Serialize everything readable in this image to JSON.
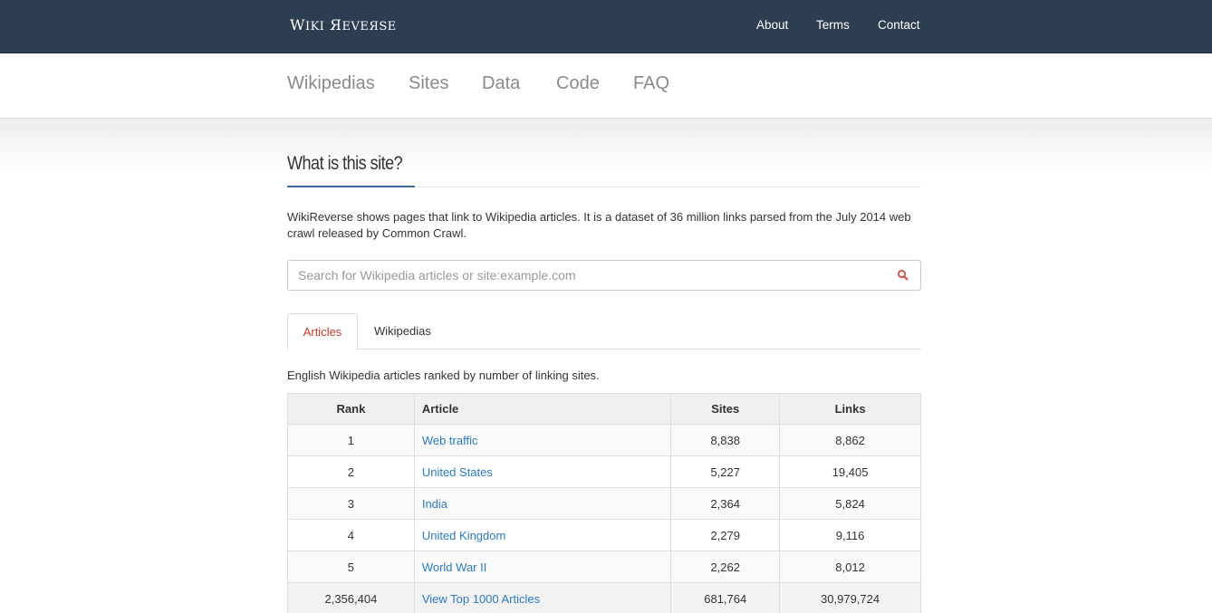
{
  "topbar": {
    "brand_part1": "W",
    "brand_part2": "IKI",
    "brand_part3": "Я",
    "brand_part4": "EVEЯSE",
    "links": [
      "About",
      "Terms",
      "Contact"
    ]
  },
  "subnav": {
    "items": [
      "Wikipedias",
      "Sites",
      "Data",
      "Code",
      "FAQ"
    ]
  },
  "main": {
    "heading": "What is this site?",
    "intro": "WikiReverse shows pages that link to Wikipedia articles. It is a dataset of 36 million links parsed from the July 2014 web crawl released by Common Crawl.",
    "search_placeholder": "Search for Wikipedia articles or site:example.com",
    "tabs": [
      "Articles",
      "Wikipedias"
    ],
    "caption": "English Wikipedia articles ranked by number of linking sites.",
    "table": {
      "headers": [
        "Rank",
        "Article",
        "Sites",
        "Links"
      ],
      "rows": [
        {
          "rank": "1",
          "article": "Web traffic",
          "sites": "8,838",
          "links": "8,862"
        },
        {
          "rank": "2",
          "article": "United States",
          "sites": "5,227",
          "links": "19,405"
        },
        {
          "rank": "3",
          "article": "India",
          "sites": "2,364",
          "links": "5,824"
        },
        {
          "rank": "4",
          "article": "United Kingdom",
          "sites": "2,279",
          "links": "9,116"
        },
        {
          "rank": "5",
          "article": "World War II",
          "sites": "2,262",
          "links": "8,012"
        }
      ],
      "total": {
        "rank": "2,356,404",
        "article": "View Top 1000 Articles",
        "sites": "681,764",
        "links": "30,979,724"
      }
    }
  },
  "colors": {
    "topbar": "#2d3e50",
    "accent": "#c0392b",
    "link": "#2b7bc0"
  },
  "icons": {
    "search": "search-icon"
  }
}
